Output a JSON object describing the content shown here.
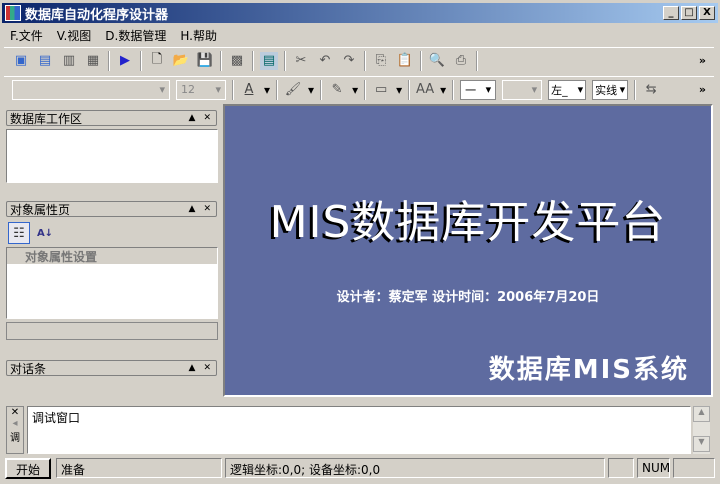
{
  "window": {
    "title": "数据库自动化程序设计器",
    "min": "_",
    "max": "□",
    "close": "X"
  },
  "menu": [
    "F.文件",
    "V.视图",
    "D.数据管理",
    "H.帮助"
  ],
  "toolbar2": {
    "font_size": "12",
    "line_style": "一",
    "align": "左_",
    "line_type": "实线",
    "more": "»"
  },
  "toolbar1": {
    "more": "»"
  },
  "panels": {
    "workspace": "数据库工作区",
    "properties": "对象属性页",
    "property_header": "对象属性设置",
    "dialog": "对话条"
  },
  "splash": {
    "title": "MIS数据库开发平台",
    "subtitle": "设计者：蔡定军 设计时间：2006年7月20日",
    "system": "数据库MIS系统"
  },
  "debug": {
    "text": "调试窗口",
    "side_label": "调"
  },
  "status": {
    "start": "开始",
    "ready": "准备",
    "coords": "逻辑坐标:0,0; 设备坐标:0,0",
    "num": "NUM"
  }
}
